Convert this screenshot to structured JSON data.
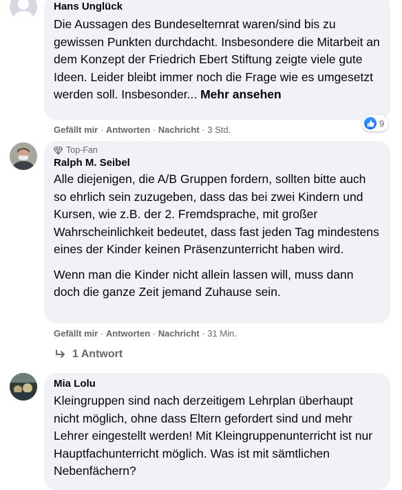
{
  "comments": [
    {
      "author": "Hans Unglück",
      "text": "Die Aussagen des Bundeselternrat waren/sind bis zu gewissen Punkten durchdacht. Insbesondere die Mitarbeit an dem Konzept der Friedrich Ebert Stiftung zeigte viele gute Ideen. Leider bleibt immer noch die Frage wie es umgesetzt werden soll. Insbesonder...",
      "more_label": "Mehr ansehen",
      "reaction_count": "9",
      "actions": {
        "like": "Gefällt mir",
        "reply": "Antworten",
        "message": "Nachricht",
        "time": "3 Std."
      }
    },
    {
      "badge": "Top-Fan",
      "author": "Ralph M. Seibel",
      "paragraphs": [
        "Alle diejenigen, die A/B Gruppen fordern, sollten bitte auch so ehrlich sein zuzugeben, dass das bei zwei Kindern und Kursen, wie z.B. der 2. Fremdsprache, mit großer Wahrscheinlichkeit bedeutet, dass fast jeden Tag mindestens eines der Kinder keinen Präsenzunterricht haben wird.",
        "Wenn man die Kinder nicht allein lassen will, muss dann doch die ganze Zeit jemand Zuhause sein."
      ],
      "actions": {
        "like": "Gefällt mir",
        "reply": "Antworten",
        "message": "Nachricht",
        "time": "31 Min."
      },
      "replies_label": "1 Antwort"
    },
    {
      "author": "Mia Lolu",
      "text": "Kleingruppen sind nach derzeitigem Lehrplan überhaupt nicht möglich, ohne dass Eltern gefordert sind und mehr Lehrer eingestellt werden! Mit Kleingruppenunterricht ist nur Hauptfachunterricht möglich. Was ist mit sämtlichen Nebenfächern?"
    }
  ],
  "colors": {
    "bubble": "#f0f2f5",
    "muted": "#65676b",
    "like_blue": "#0866ff"
  },
  "icons": [
    "avatar-placeholder",
    "diamond-icon",
    "like-icon",
    "reply-arrow-icon"
  ]
}
